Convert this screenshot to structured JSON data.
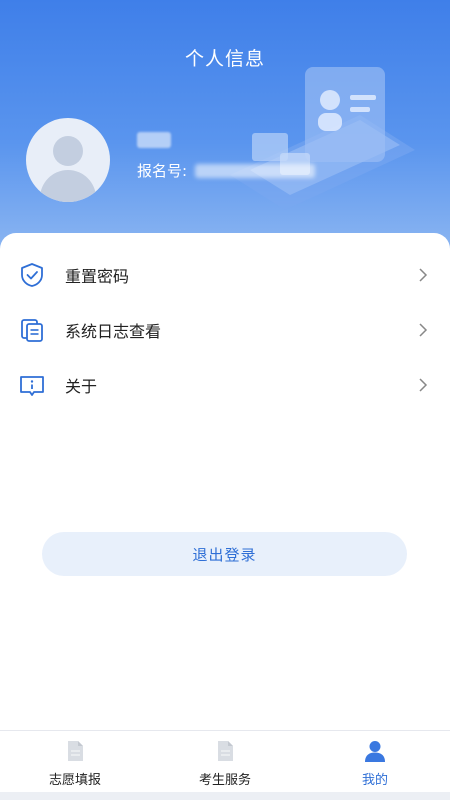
{
  "header": {
    "title": "个人信息",
    "registration_label": "报名号:"
  },
  "menu": [
    {
      "label": "重置密码",
      "icon": "shield-check-icon"
    },
    {
      "label": "系统日志查看",
      "icon": "documents-icon"
    },
    {
      "label": "关于",
      "icon": "info-icon"
    }
  ],
  "logout_label": "退出登录",
  "tabbar": [
    {
      "label": "志愿填报",
      "icon": "document-icon",
      "active": false
    },
    {
      "label": "考生服务",
      "icon": "document-icon",
      "active": false
    },
    {
      "label": "我的",
      "icon": "person-icon",
      "active": true
    }
  ],
  "colors": {
    "accent": "#2f6fd6",
    "header_gradient_top": "#3f7fe9",
    "header_gradient_bottom": "#8fb8f2"
  }
}
